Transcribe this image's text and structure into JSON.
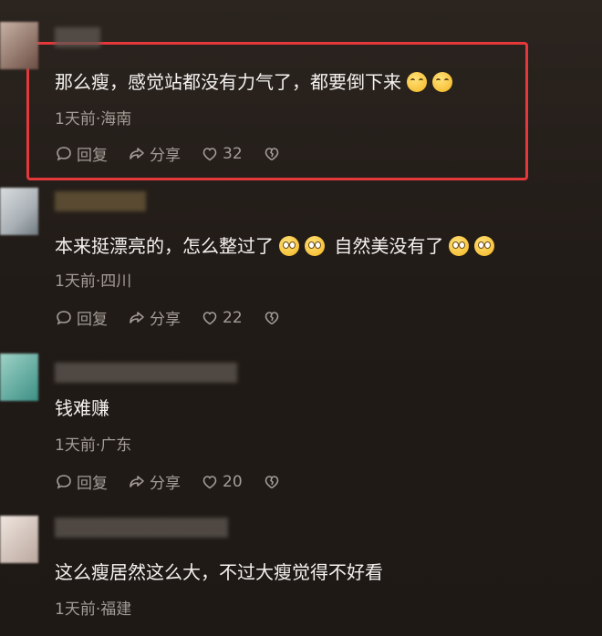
{
  "comments": [
    {
      "text": "那么瘦，感觉站都没有力气了，都要倒下来",
      "emojis": [
        "laughing-tears",
        "laughing-tears"
      ],
      "meta": "1天前·海南",
      "reply_label": "回复",
      "share_label": "分享",
      "likes": "32"
    },
    {
      "text": "本来挺漂亮的，怎么整过了",
      "text_after": "自然美没有了",
      "emojis": [
        "dizzy-face",
        "dizzy-face",
        "dizzy-face",
        "dizzy-face"
      ],
      "meta": "1天前·四川",
      "reply_label": "回复",
      "share_label": "分享",
      "likes": "22"
    },
    {
      "text": "钱难赚",
      "meta": "1天前·广东",
      "reply_label": "回复",
      "share_label": "分享",
      "likes": "20"
    },
    {
      "text": "这么瘦居然这么大，不过大瘦觉得不好看",
      "meta": "1天前·福建"
    }
  ],
  "colors": {
    "highlight": "#e4383b",
    "meta": "#a39c96",
    "text": "#f4f2f0"
  }
}
